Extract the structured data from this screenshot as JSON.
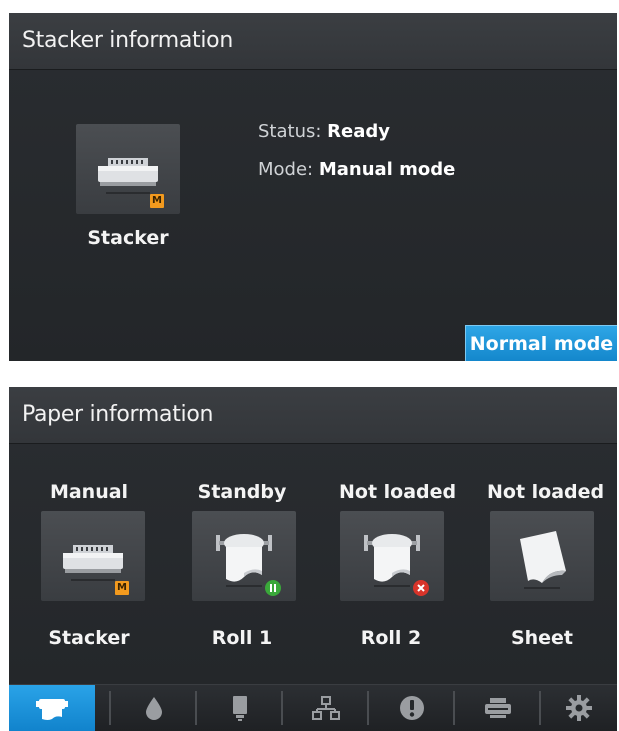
{
  "stacker_panel": {
    "title": "Stacker information",
    "device_label": "Stacker",
    "badge_letter": "M",
    "status_key": "Status:",
    "status_value": "Ready",
    "mode_key": "Mode:",
    "mode_value": "Manual mode",
    "normal_mode_button": "Normal mode"
  },
  "paper_panel": {
    "title": "Paper information",
    "sources": [
      {
        "state": "Manual",
        "name": "Stacker",
        "badge": "M"
      },
      {
        "state": "Standby",
        "name": "Roll 1",
        "badge": "pause"
      },
      {
        "state": "Not loaded",
        "name": "Roll 2",
        "badge": "error"
      },
      {
        "state": "Not loaded",
        "name": "Sheet",
        "badge": ""
      }
    ]
  },
  "navbar": {
    "items": [
      {
        "icon": "paper-icon",
        "active": true
      },
      {
        "icon": "ink-drop-icon",
        "active": false
      },
      {
        "icon": "printhead-icon",
        "active": false
      },
      {
        "icon": "network-icon",
        "active": false
      },
      {
        "icon": "alert-icon",
        "active": false
      },
      {
        "icon": "printer-icon",
        "active": false
      },
      {
        "icon": "settings-gear-icon",
        "active": false
      }
    ]
  },
  "colors": {
    "accent_blue": "#1a92d8",
    "badge_orange": "#f39a1e",
    "pause_green": "#3aa83a",
    "error_red": "#d8342a"
  }
}
